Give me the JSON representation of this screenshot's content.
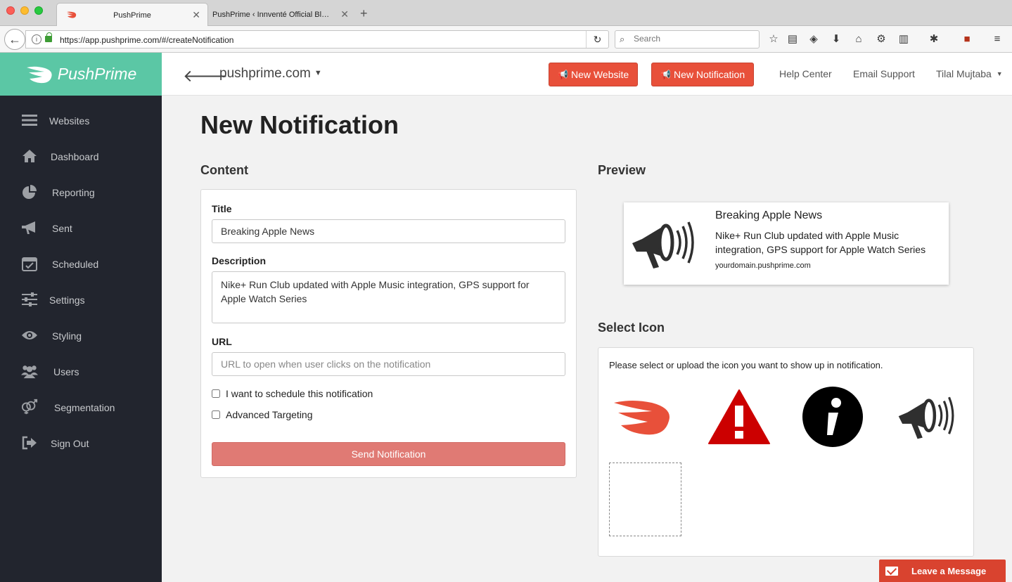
{
  "browser": {
    "tabs": [
      {
        "title": "PushPrime",
        "active": true
      },
      {
        "title": "PushPrime ‹ Innventé Official Bl…",
        "active": false
      }
    ],
    "url": "https://app.pushprime.com/#/createNotification",
    "search_placeholder": "Search"
  },
  "brand": {
    "name": "PushPrime",
    "accent": "#5bc7a5",
    "sidebar_bg": "#22252e",
    "red": "#e8503a"
  },
  "header": {
    "site": "pushprime.com",
    "new_website": "New Website",
    "new_notification": "New Notification",
    "help_center": "Help Center",
    "email_support": "Email Support",
    "user": "Tilal Mujtaba"
  },
  "sidebar": {
    "items": [
      {
        "label": "Websites",
        "icon": "menu-icon"
      },
      {
        "label": "Dashboard",
        "icon": "home-icon"
      },
      {
        "label": "Reporting",
        "icon": "pie-chart-icon"
      },
      {
        "label": "Sent",
        "icon": "megaphone-icon"
      },
      {
        "label": "Scheduled",
        "icon": "calendar-icon"
      },
      {
        "label": "Settings",
        "icon": "sliders-icon"
      },
      {
        "label": "Styling",
        "icon": "eye-icon"
      },
      {
        "label": "Users",
        "icon": "users-icon"
      },
      {
        "label": "Segmentation",
        "icon": "gender-icon"
      },
      {
        "label": "Sign Out",
        "icon": "sign-out-icon"
      }
    ]
  },
  "page": {
    "title": "New Notification",
    "content_heading": "Content",
    "preview_heading": "Preview",
    "select_icon_heading": "Select Icon"
  },
  "form": {
    "title_label": "Title",
    "title_value": "Breaking Apple News",
    "description_label": "Description",
    "description_value": "Nike+ Run Club updated with Apple Music integration, GPS support for Apple Watch Series",
    "url_label": "URL",
    "url_placeholder": "URL to open when user clicks on the notification",
    "schedule_label": "I want to schedule this notification",
    "targeting_label": "Advanced Targeting",
    "send_label": "Send Notification"
  },
  "preview": {
    "title": "Breaking Apple News",
    "description": "Nike+ Run Club updated with Apple Music integration, GPS support for Apple Watch Series",
    "domain": "yourdomain.pushprime.com"
  },
  "icons": {
    "instruction": "Please select or upload the icon you want to show up in notification.",
    "choices": [
      "pushprime-logo-icon",
      "warning-icon",
      "info-icon",
      "megaphone-icon"
    ]
  },
  "chat": {
    "label": "Leave a Message"
  }
}
